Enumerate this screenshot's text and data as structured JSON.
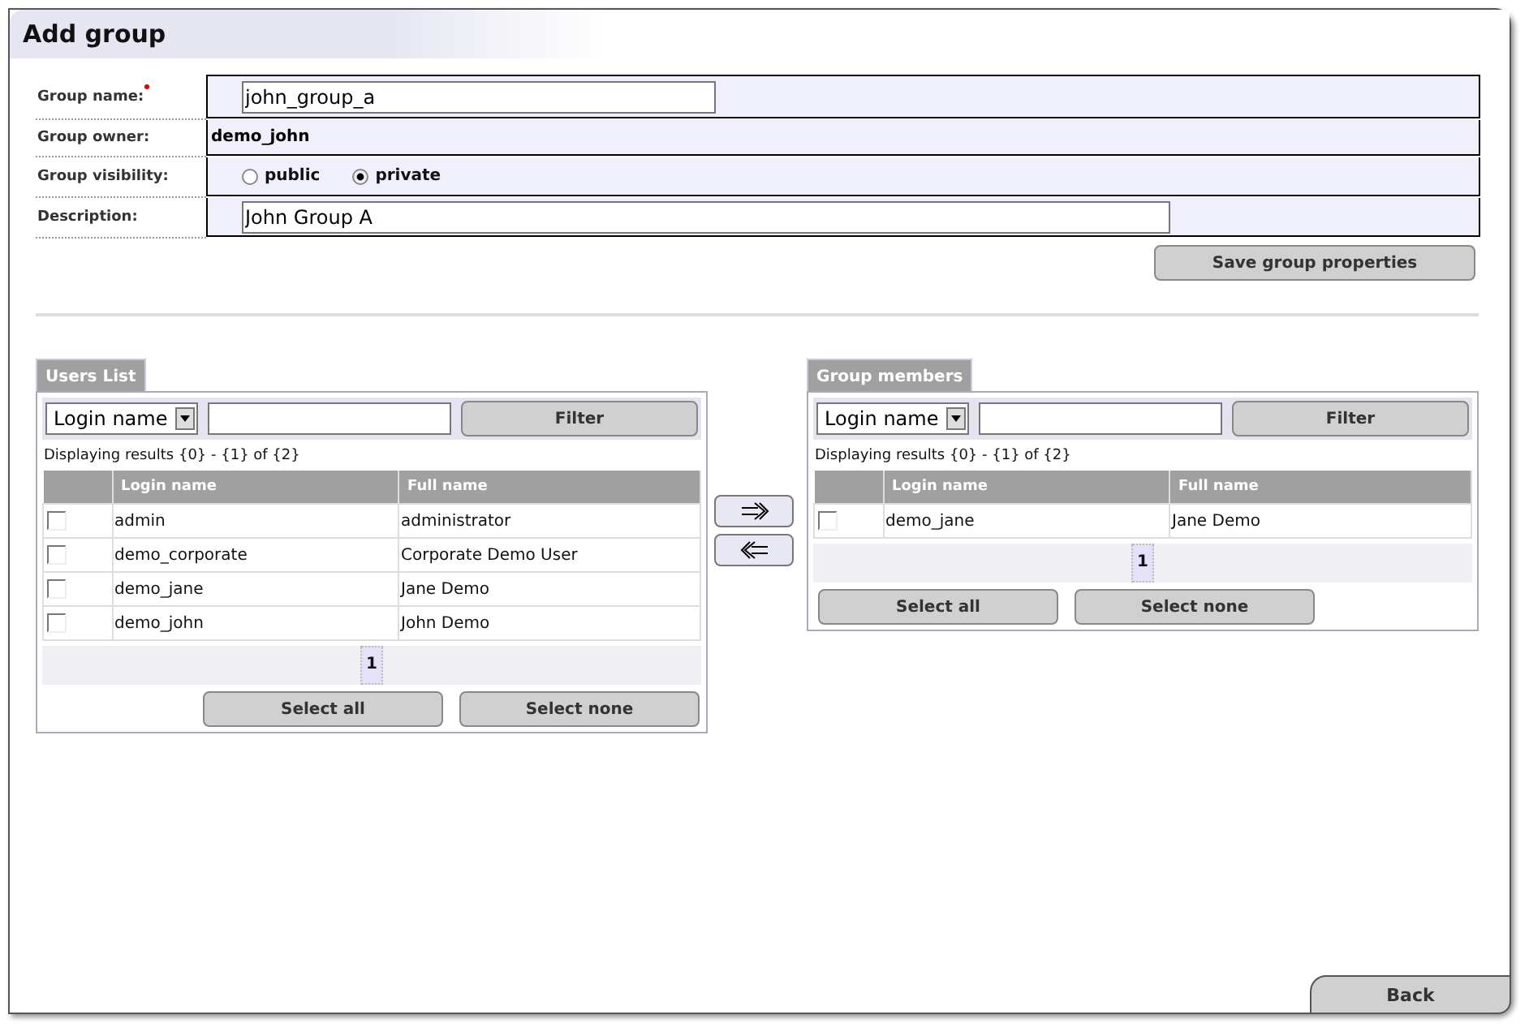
{
  "window": {
    "title": "Add group"
  },
  "form": {
    "name_label": "Group name:",
    "name_value": "john_group_a",
    "owner_label": "Group owner:",
    "owner_value": "demo_john",
    "visibility_label": "Group visibility:",
    "visibility_options": [
      {
        "label": "public",
        "selected": false
      },
      {
        "label": "private",
        "selected": true
      }
    ],
    "description_label": "Description:",
    "description_value": "John Group A",
    "save_button": "Save group properties"
  },
  "panels": [
    {
      "title": "Users List",
      "filter_select": "Login name",
      "filter_button": "Filter",
      "results": "Displaying results {0} - {1} of {2}",
      "columns": [
        "Login name",
        "Full name"
      ],
      "rows": [
        {
          "login": "admin",
          "full_name": "administrator",
          "checked": false
        },
        {
          "login": "demo_corporate",
          "full_name": "Corporate Demo User",
          "checked": false
        },
        {
          "login": "demo_jane",
          "full_name": "Jane Demo",
          "checked": false
        },
        {
          "login": "demo_john",
          "full_name": "John Demo",
          "checked": false
        }
      ],
      "page": "1",
      "select_all": "Select all",
      "select_none": "Select none"
    },
    {
      "title": "Group members",
      "filter_select": "Login name",
      "filter_button": "Filter",
      "results": "Displaying results {0} - {1} of {2}",
      "columns": [
        "Login name",
        "Full name"
      ],
      "rows": [
        {
          "login": "demo_jane",
          "full_name": "Jane Demo",
          "checked": false
        }
      ],
      "page": "1",
      "select_all": "Select all",
      "select_none": "Select none"
    }
  ],
  "back_button": "Back"
}
